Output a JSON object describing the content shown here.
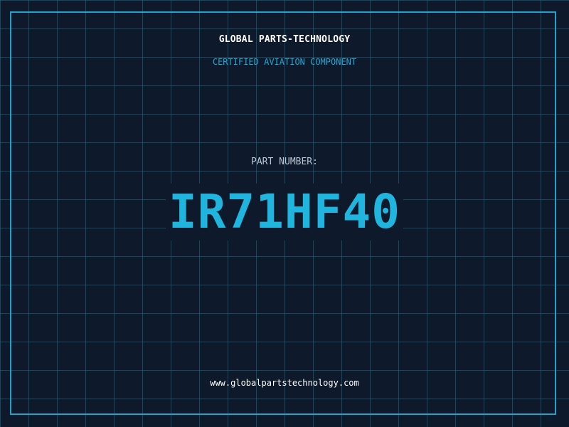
{
  "header": {
    "company": "GLOBAL PARTS-TECHNOLOGY",
    "subtitle": "CERTIFIED AVIATION COMPONENT"
  },
  "part": {
    "label": "PART NUMBER:",
    "number": "IR71HF40"
  },
  "footer": {
    "website": "www.globalpartstechnology.com"
  },
  "colors": {
    "background": "#0e1a2b",
    "grid": "#1e6e8c",
    "frame": "#1fa3c9",
    "accent": "#1fb5de"
  }
}
